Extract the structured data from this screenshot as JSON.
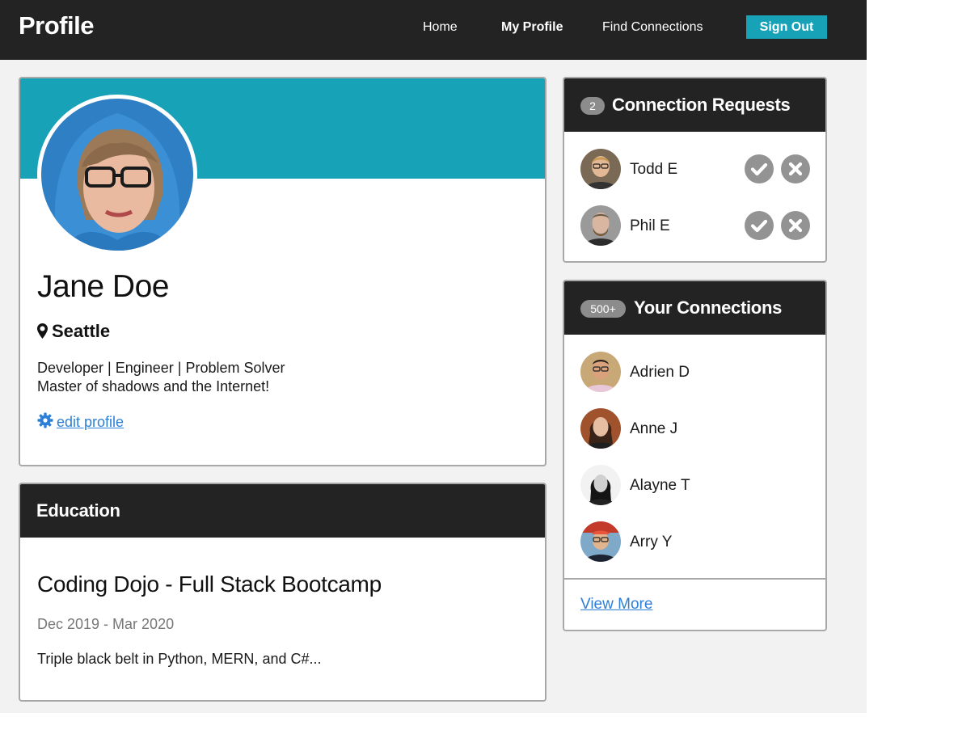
{
  "navbar": {
    "brand": "Profile",
    "links": [
      {
        "label": "Home",
        "active": false
      },
      {
        "label": "My Profile",
        "active": true
      },
      {
        "label": "Find Connections",
        "active": false
      }
    ],
    "sign_out_label": "Sign Out"
  },
  "profile": {
    "name": "Jane Doe",
    "location": "Seattle",
    "bio": [
      "Developer | Engineer | Problem Solver",
      "Master of shadows and the Internet!"
    ],
    "edit_label": "edit profile"
  },
  "education": {
    "title": "Education",
    "school": "Coding Dojo - Full Stack Bootcamp",
    "dates": "Dec 2019 - Mar 2020",
    "description": "Triple black belt in Python, MERN, and C#..."
  },
  "requests": {
    "count": "2",
    "title": "Connection Requests",
    "items": [
      {
        "name": "Todd E"
      },
      {
        "name": "Phil E"
      }
    ]
  },
  "connections": {
    "count": "500+",
    "title": "Your Connections",
    "items": [
      {
        "name": "Adrien D"
      },
      {
        "name": "Anne J"
      },
      {
        "name": "Alayne T"
      },
      {
        "name": "Arry Y"
      }
    ],
    "view_more_label": "View More"
  },
  "colors": {
    "navbar_bg": "#232323",
    "accent_teal": "#17a2b8",
    "link_blue": "#2d7fd7",
    "badge_gray": "#8c8c8c",
    "page_bg": "#f2f2f2"
  },
  "icons": {
    "location": "map-marker-icon",
    "edit": "gear-icon",
    "accept": "check-circle-icon",
    "decline": "x-circle-icon"
  }
}
